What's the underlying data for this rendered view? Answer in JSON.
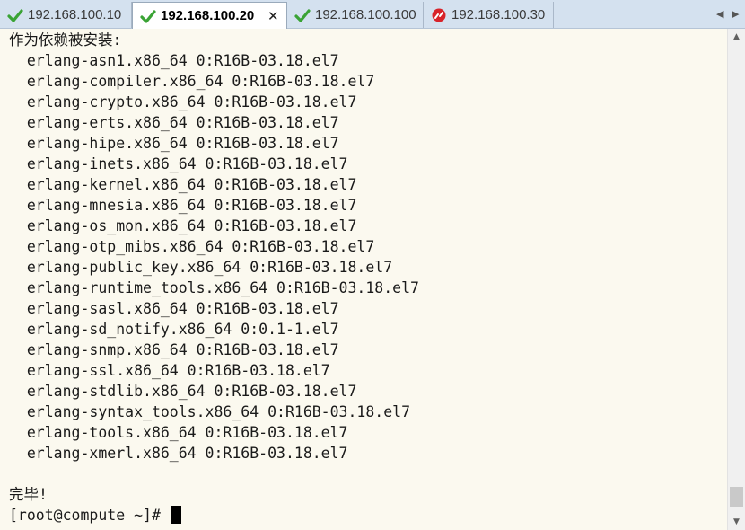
{
  "tabs": [
    {
      "label": "192.168.100.10",
      "status": "connected",
      "icon": "green-check-icon",
      "active": false
    },
    {
      "label": "192.168.100.20",
      "status": "connected",
      "icon": "green-check-icon",
      "active": true
    },
    {
      "label": "192.168.100.100",
      "status": "connected",
      "icon": "green-check-icon",
      "active": false
    },
    {
      "label": "192.168.100.30",
      "status": "disconnected",
      "icon": "red-disconnect-icon",
      "active": false
    }
  ],
  "tab_close_glyph": "✕",
  "nav": {
    "left": "◀",
    "right": "▶"
  },
  "terminal": {
    "lines": [
      "作为依赖被安装:",
      "  erlang-asn1.x86_64 0:R16B-03.18.el7",
      "  erlang-compiler.x86_64 0:R16B-03.18.el7",
      "  erlang-crypto.x86_64 0:R16B-03.18.el7",
      "  erlang-erts.x86_64 0:R16B-03.18.el7",
      "  erlang-hipe.x86_64 0:R16B-03.18.el7",
      "  erlang-inets.x86_64 0:R16B-03.18.el7",
      "  erlang-kernel.x86_64 0:R16B-03.18.el7",
      "  erlang-mnesia.x86_64 0:R16B-03.18.el7",
      "  erlang-os_mon.x86_64 0:R16B-03.18.el7",
      "  erlang-otp_mibs.x86_64 0:R16B-03.18.el7",
      "  erlang-public_key.x86_64 0:R16B-03.18.el7",
      "  erlang-runtime_tools.x86_64 0:R16B-03.18.el7",
      "  erlang-sasl.x86_64 0:R16B-03.18.el7",
      "  erlang-sd_notify.x86_64 0:0.1-1.el7",
      "  erlang-snmp.x86_64 0:R16B-03.18.el7",
      "  erlang-ssl.x86_64 0:R16B-03.18.el7",
      "  erlang-stdlib.x86_64 0:R16B-03.18.el7",
      "  erlang-syntax_tools.x86_64 0:R16B-03.18.el7",
      "  erlang-tools.x86_64 0:R16B-03.18.el7",
      "  erlang-xmerl.x86_64 0:R16B-03.18.el7",
      "",
      "完毕!"
    ],
    "prompt": "[root@compute ~]# "
  },
  "scrollbar": {
    "up": "▲",
    "down": "▼",
    "position_fraction": 0.96
  },
  "colors": {
    "tab_bar": "#d4e1ef",
    "terminal_bg": "#fbf9ef",
    "connected": "#3aa335",
    "disconnected": "#d8232a"
  }
}
